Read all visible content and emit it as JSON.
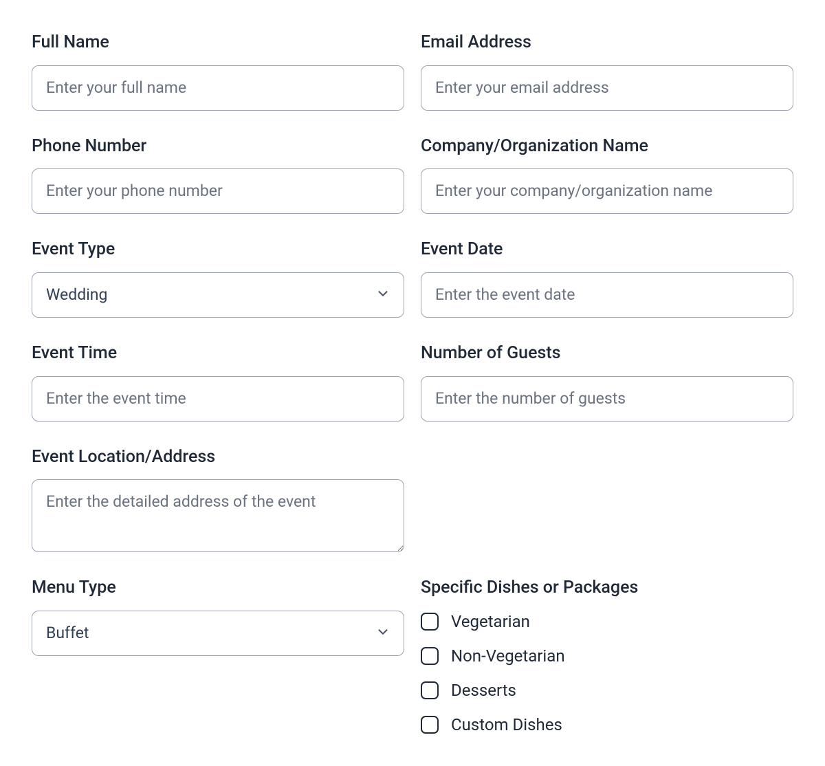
{
  "fields": {
    "full_name": {
      "label": "Full Name",
      "placeholder": "Enter your full name"
    },
    "email": {
      "label": "Email Address",
      "placeholder": "Enter your email address"
    },
    "phone": {
      "label": "Phone Number",
      "placeholder": "Enter your phone number"
    },
    "company": {
      "label": "Company/Organization Name",
      "placeholder": "Enter your company/organization name"
    },
    "event_type": {
      "label": "Event Type",
      "selected": "Wedding"
    },
    "event_date": {
      "label": "Event Date",
      "placeholder": "Enter the event date"
    },
    "event_time": {
      "label": "Event Time",
      "placeholder": "Enter the event time"
    },
    "guests": {
      "label": "Number of Guests",
      "placeholder": "Enter the number of guests"
    },
    "location": {
      "label": "Event Location/Address",
      "placeholder": "Enter the detailed address of the event"
    },
    "menu_type": {
      "label": "Menu Type",
      "selected": "Buffet"
    },
    "dishes": {
      "label": "Specific Dishes or Packages",
      "options": [
        "Vegetarian",
        "Non-Vegetarian",
        "Desserts",
        "Custom Dishes"
      ]
    }
  }
}
